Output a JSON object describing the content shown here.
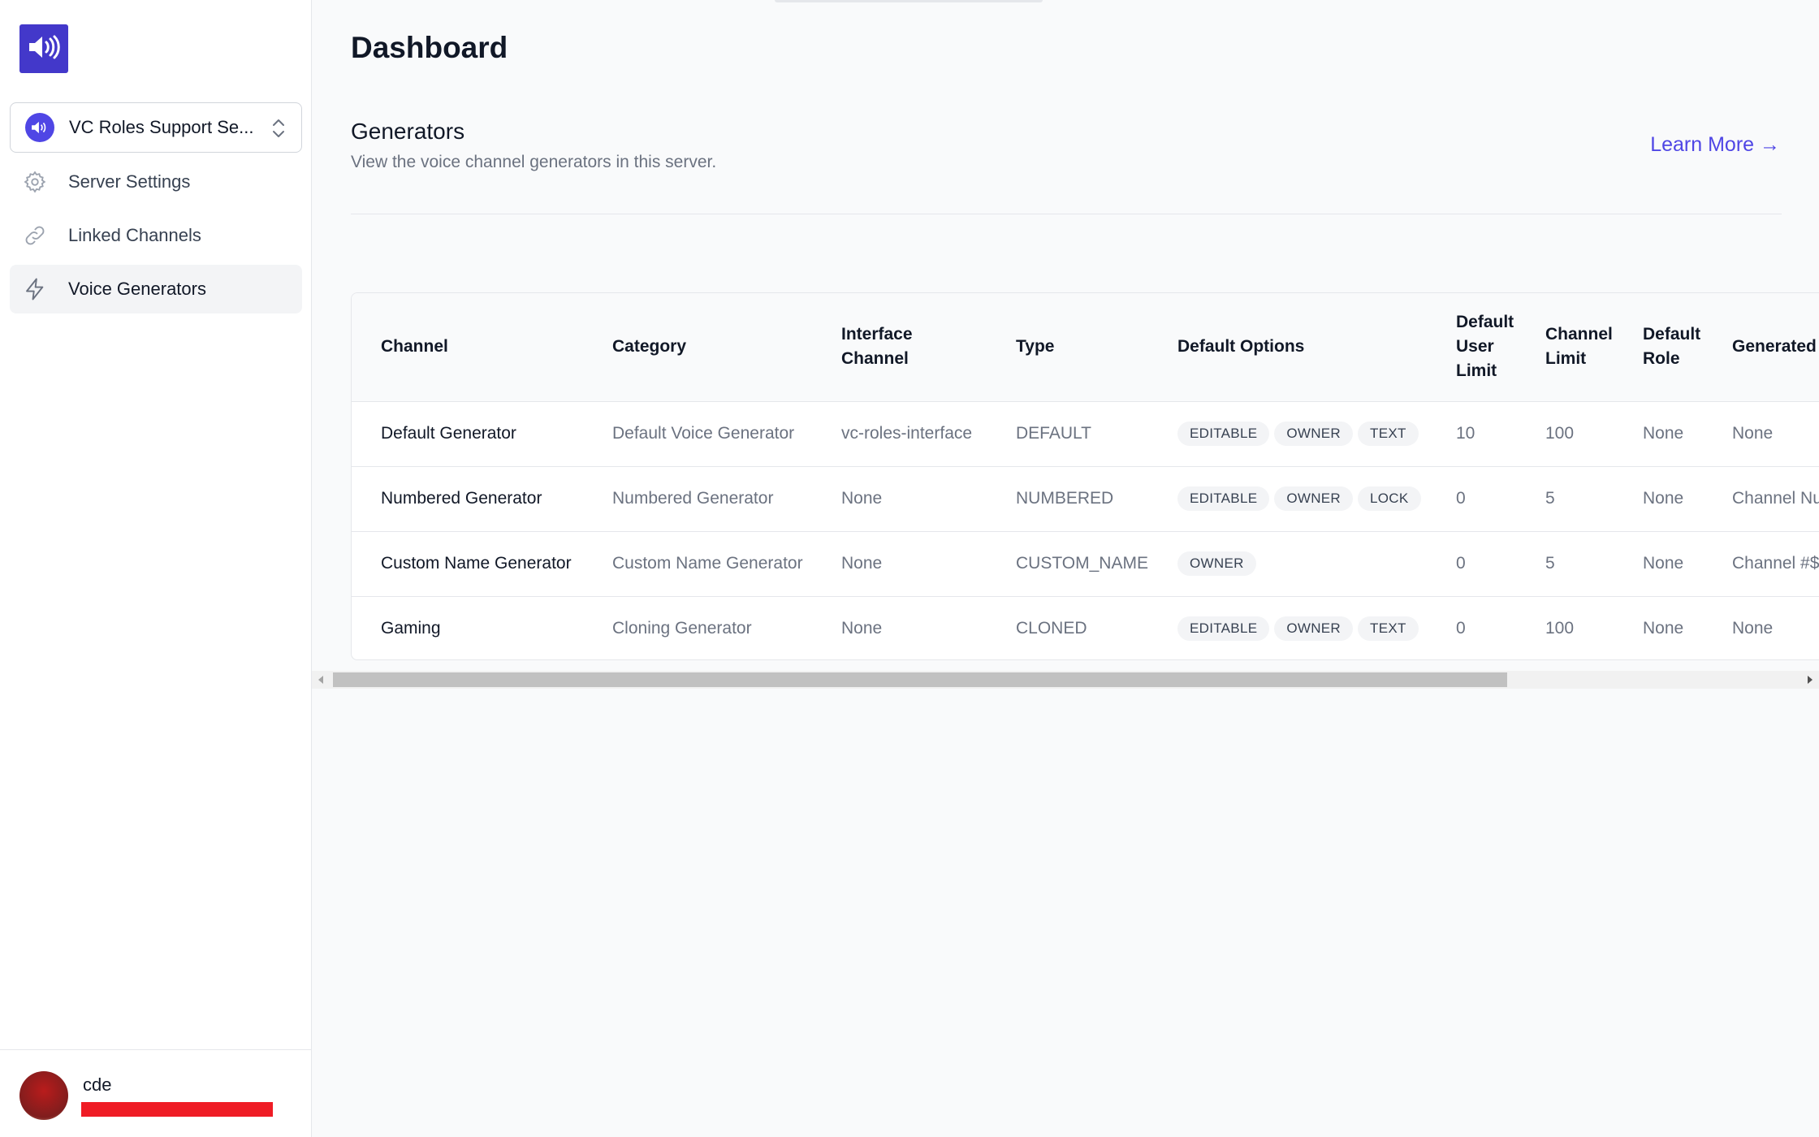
{
  "sidebar": {
    "logo_icon": "speaker-icon",
    "server": {
      "name": "VC Roles Support Se...",
      "icon": "speaker-icon"
    },
    "items": [
      {
        "label": "Server Settings",
        "icon": "gear-icon"
      },
      {
        "label": "Linked Channels",
        "icon": "link-icon"
      },
      {
        "label": "Voice Generators",
        "icon": "lightning-icon",
        "active": true
      }
    ],
    "user": {
      "name": "cde"
    }
  },
  "page": {
    "title": "Dashboard",
    "section": {
      "title": "Generators",
      "description": "View the voice channel generators in this server.",
      "learn_more": "Learn More →"
    }
  },
  "table": {
    "headers": [
      "Channel",
      "Category",
      "Interface Channel",
      "Type",
      "Default Options",
      "Default User Limit",
      "Channel Limit",
      "Default Role",
      "Generated"
    ],
    "rows": [
      {
        "channel": "Default Generator",
        "category": "Default Voice Generator",
        "interface": "vc-roles-interface",
        "type": "DEFAULT",
        "options": [
          "EDITABLE",
          "OWNER",
          "TEXT"
        ],
        "user_limit": "10",
        "channel_limit": "100",
        "role": "None",
        "generated": "None"
      },
      {
        "channel": "Numbered Generator",
        "category": "Numbered Generator",
        "interface": "None",
        "type": "NUMBERED",
        "options": [
          "EDITABLE",
          "OWNER",
          "LOCK"
        ],
        "user_limit": "0",
        "channel_limit": "5",
        "role": "None",
        "generated": "Channel Nu"
      },
      {
        "channel": "Custom Name Generator",
        "category": "Custom Name Generator",
        "interface": "None",
        "type": "CUSTOM_NAME",
        "options": [
          "OWNER"
        ],
        "user_limit": "0",
        "channel_limit": "5",
        "role": "None",
        "generated": "Channel #$"
      },
      {
        "channel": "Gaming",
        "category": "Cloning Generator",
        "interface": "None",
        "type": "CLONED",
        "options": [
          "EDITABLE",
          "OWNER",
          "TEXT"
        ],
        "user_limit": "0",
        "channel_limit": "100",
        "role": "None",
        "generated": "None"
      }
    ]
  },
  "colors": {
    "accent": "#4f46e5",
    "logo_bg": "#4338ca",
    "redacted_bar": "#ef1c25"
  }
}
